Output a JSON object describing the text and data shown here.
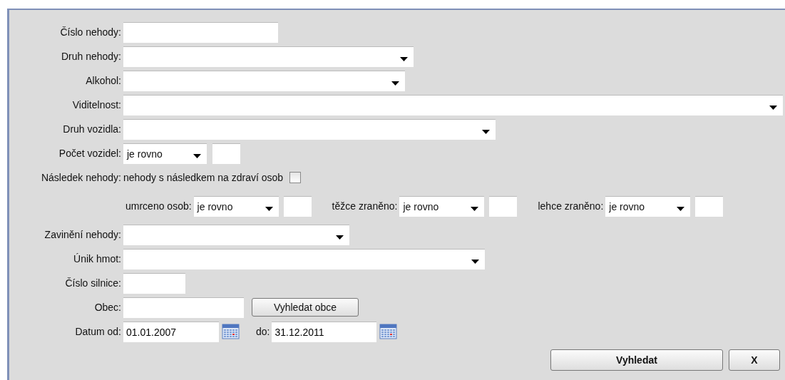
{
  "form": {
    "rows": [
      {
        "kind": "text",
        "label": "Číslo nehody:"
      },
      {
        "kind": "select",
        "label": "Druh nehody:"
      },
      {
        "kind": "select",
        "label": "Alkohol:"
      },
      {
        "kind": "select",
        "label": "Viditelnost:"
      },
      {
        "kind": "select",
        "label": "Druh vozidla:"
      },
      {
        "kind": "compare",
        "label": "Počet vozidel:",
        "value": "je rovno"
      },
      {
        "kind": "checkbox",
        "label": "Následek nehody:",
        "text": "nehody s následkem na zdraví osob",
        "checked": false
      },
      {
        "kind": "compare_group",
        "items": [
          {
            "label": "umrceno osob:",
            "value": "je rovno"
          },
          {
            "label": "těžce zraněno:",
            "value": "je rovno"
          },
          {
            "label": "lehce zraněno:",
            "value": "je rovno"
          }
        ]
      },
      {
        "kind": "select",
        "label": "Zavinění nehody:"
      },
      {
        "kind": "select",
        "label": "Únik hmot:"
      },
      {
        "kind": "text",
        "label": "Číslo silnice:"
      },
      {
        "kind": "search",
        "label": "Obec:",
        "button": "Vyhledat obce"
      },
      {
        "kind": "date_range",
        "label": "Datum od:",
        "from": "01.01.2007",
        "to_label": "do:",
        "to": "31.12.2011"
      }
    ],
    "actions": [
      "Vyhledat",
      "X"
    ]
  }
}
